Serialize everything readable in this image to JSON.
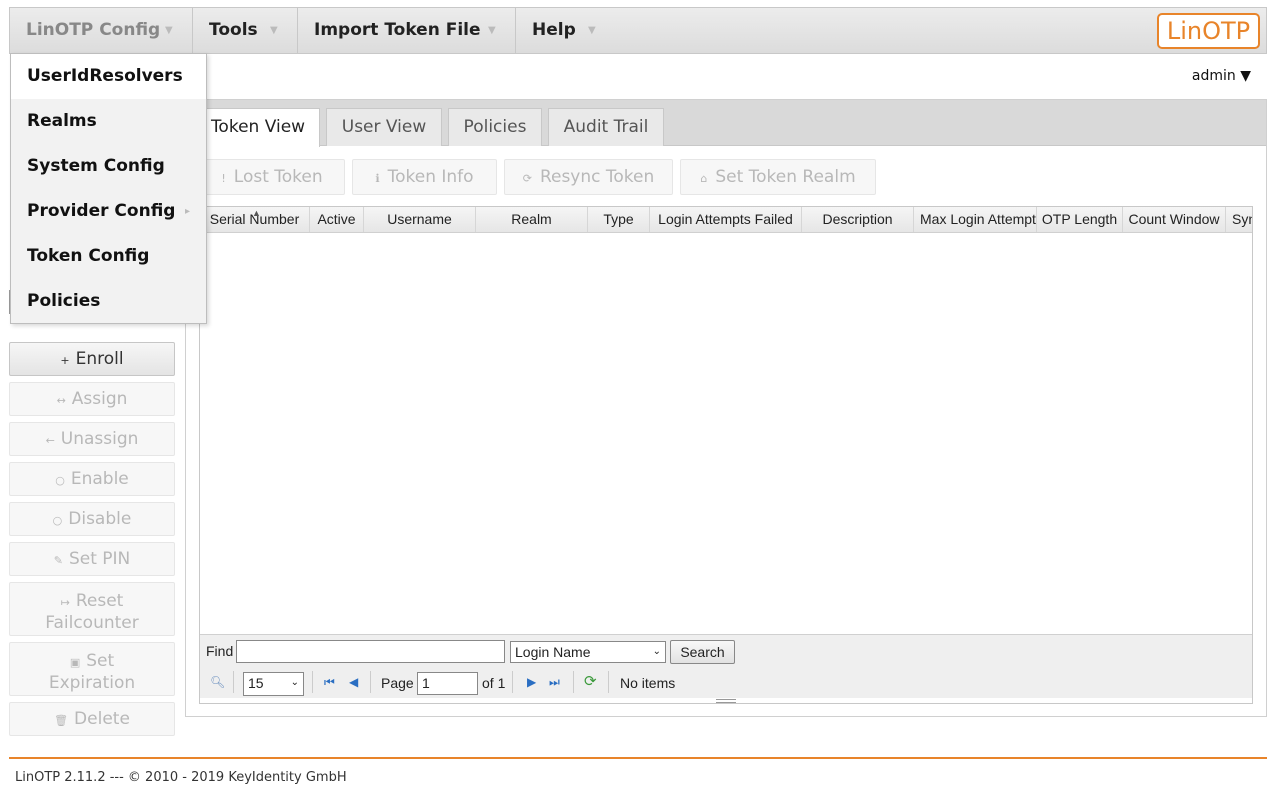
{
  "menubar": {
    "items": [
      {
        "label": "LinOTP Config"
      },
      {
        "label": "Tools"
      },
      {
        "label": "Import Token File"
      },
      {
        "label": "Help"
      }
    ],
    "logo": "LinOTP"
  },
  "dropdown": {
    "items": [
      {
        "label": "UserIdResolvers"
      },
      {
        "label": "Realms"
      },
      {
        "label": "System Config"
      },
      {
        "label": "Provider Config"
      },
      {
        "label": "Token Config"
      },
      {
        "label": "Policies"
      }
    ]
  },
  "user": {
    "name": "admin ▼"
  },
  "sidebar": {
    "buttons": [
      {
        "label": "Enroll",
        "icon": "+"
      },
      {
        "label": "Assign",
        "icon": "↔"
      },
      {
        "label": "Unassign",
        "icon": "←"
      },
      {
        "label": "Enable",
        "icon": "○"
      },
      {
        "label": "Disable",
        "icon": "○"
      },
      {
        "label": "Set PIN",
        "icon": "✎"
      },
      {
        "label": "Reset Failcounter",
        "icon": "↦"
      },
      {
        "label": "Set Expiration",
        "icon": "▣"
      },
      {
        "label": "Delete",
        "icon": "🗑"
      }
    ]
  },
  "tabs": [
    {
      "label": "Token View"
    },
    {
      "label": "User View"
    },
    {
      "label": "Policies"
    },
    {
      "label": "Audit Trail"
    }
  ],
  "toolbar": [
    {
      "label": "Lost Token",
      "icon": "!"
    },
    {
      "label": "Token Info",
      "icon": "ℹ"
    },
    {
      "label": "Resync Token",
      "icon": "⟳"
    },
    {
      "label": "Set Token Realm",
      "icon": "⌂"
    }
  ],
  "grid": {
    "columns": [
      "Serial Number",
      "Active",
      "Username",
      "Realm",
      "Type",
      "Login Attempts Failed",
      "Description",
      "Max Login Attempts",
      "OTP Length",
      "Count Window",
      "Sync"
    ],
    "find_label": "Find",
    "search_field_selected": "Login Name",
    "search_button": "Search",
    "page_size": "15",
    "page_label": "Page",
    "page_value": "1",
    "of_label": "of 1",
    "status": "No items"
  },
  "footer": {
    "text": "LinOTP 2.11.2 --- © 2010 - 2019 KeyIdentity GmbH"
  },
  "colors": {
    "accent": "#e8842a",
    "pager_icons": "#2a6ec2"
  }
}
